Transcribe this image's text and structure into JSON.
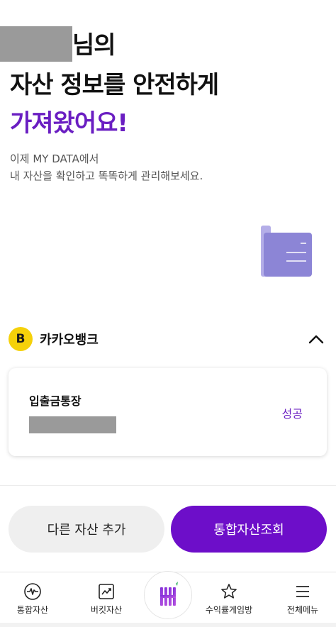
{
  "headline": {
    "suffix": "님의",
    "line2": "자산 정보를 안전하게",
    "line3": "가져왔어요!"
  },
  "subtext": {
    "line1": "이제 MY DATA에서",
    "line2": "내 자산을 확인하고 똑똑하게 관리해보세요."
  },
  "bank": {
    "logo_letter": "B",
    "name": "카카오뱅크",
    "accounts": [
      {
        "type": "입출금통장",
        "status": "성공"
      }
    ]
  },
  "buttons": {
    "add_asset": "다른 자산 추가",
    "integrated_lookup": "통합자산조회"
  },
  "tabbar": {
    "items": [
      {
        "label": "통합자산",
        "icon": "pulse-circle-icon"
      },
      {
        "label": "버킷자산",
        "icon": "chart-up-icon"
      },
      {
        "label": "",
        "icon": "h-logo-icon"
      },
      {
        "label": "수익률게임방",
        "icon": "star-icon"
      },
      {
        "label": "전체메뉴",
        "icon": "hamburger-menu-icon"
      }
    ]
  },
  "colors": {
    "accent": "#6d0ec9",
    "kakao_yellow": "#f5d10a",
    "doc_illustration": "#8c85d6"
  }
}
